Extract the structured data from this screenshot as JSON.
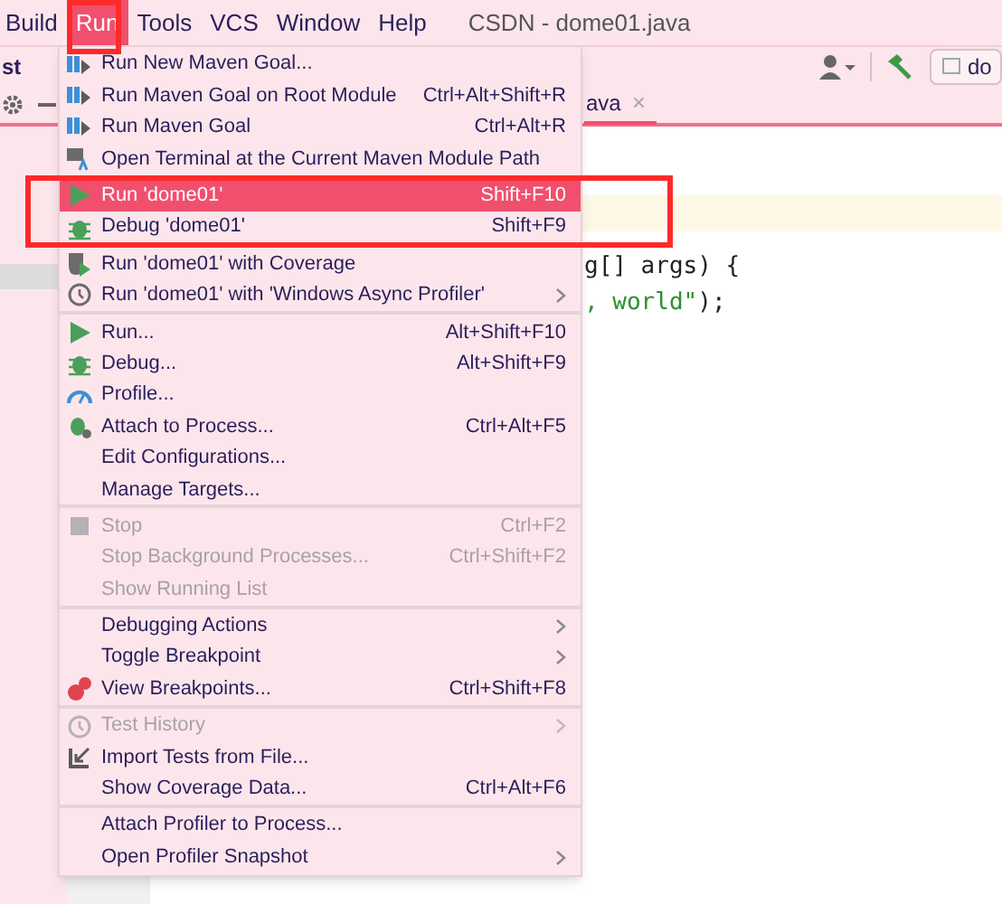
{
  "menubar": {
    "items": [
      {
        "label": "Build",
        "selected": false
      },
      {
        "label": "Run",
        "selected": true
      },
      {
        "label": "Tools",
        "selected": false
      },
      {
        "label": "VCS",
        "selected": false
      },
      {
        "label": "Window",
        "selected": false
      },
      {
        "label": "Help",
        "selected": false
      }
    ],
    "title": "CSDN - dome01.java"
  },
  "navbar": {
    "crumb": "st",
    "field": "do"
  },
  "editor": {
    "tab": {
      "label": "ava",
      "close": "×"
    },
    "lines": [
      [
        {
          "text": "g[] args) {",
          "kind": "plain"
        }
      ],
      [
        {
          "text": ", world\"",
          "kind": "string"
        },
        {
          "text": ");",
          "kind": "plain"
        }
      ]
    ]
  },
  "menu": {
    "groups": [
      [
        {
          "label": "Run New Maven Goal...",
          "submenu": false,
          "disabled": false,
          "selected": false
        },
        {
          "label": "Run Maven Goal on Root Module",
          "shortcut": "Ctrl+Alt+Shift+R",
          "submenu": false,
          "disabled": false,
          "selected": false
        },
        {
          "label": "Run Maven Goal",
          "shortcut": "Ctrl+Alt+R",
          "submenu": false,
          "disabled": false,
          "selected": false
        },
        {
          "label": "Open Terminal at the Current Maven Module Path",
          "submenu": false,
          "disabled": false,
          "selected": false
        },
        {
          "label": "Run 'dome01'",
          "shortcut": "Shift+F10",
          "submenu": false,
          "disabled": false,
          "selected": true
        },
        {
          "label": "Debug 'dome01'",
          "shortcut": "Shift+F9",
          "submenu": false,
          "disabled": false,
          "selected": false
        },
        {
          "label": "Run 'dome01' with Coverage",
          "submenu": false,
          "disabled": false,
          "selected": false
        },
        {
          "label": "Run 'dome01' with 'Windows Async Profiler'",
          "submenu": true,
          "disabled": false,
          "selected": false
        }
      ],
      [
        {
          "label": "Run...",
          "shortcut": "Alt+Shift+F10",
          "submenu": false,
          "disabled": false,
          "selected": false
        },
        {
          "label": "Debug...",
          "shortcut": "Alt+Shift+F9",
          "submenu": false,
          "disabled": false,
          "selected": false
        },
        {
          "label": "Profile...",
          "submenu": false,
          "disabled": false,
          "selected": false
        },
        {
          "label": "Attach to Process...",
          "shortcut": "Ctrl+Alt+F5",
          "submenu": false,
          "disabled": false,
          "selected": false
        },
        {
          "label": "Edit Configurations...",
          "submenu": false,
          "disabled": false,
          "selected": false
        },
        {
          "label": "Manage Targets...",
          "submenu": false,
          "disabled": false,
          "selected": false
        }
      ],
      [
        {
          "label": "Stop",
          "shortcut": "Ctrl+F2",
          "submenu": false,
          "disabled": true,
          "selected": false
        },
        {
          "label": "Stop Background Processes...",
          "shortcut": "Ctrl+Shift+F2",
          "submenu": false,
          "disabled": true,
          "selected": false
        },
        {
          "label": "Show Running List",
          "submenu": false,
          "disabled": true,
          "selected": false
        }
      ],
      [
        {
          "label": "Debugging Actions",
          "submenu": true,
          "disabled": false,
          "selected": false
        },
        {
          "label": "Toggle Breakpoint",
          "submenu": true,
          "disabled": false,
          "selected": false
        },
        {
          "label": "View Breakpoints...",
          "shortcut": "Ctrl+Shift+F8",
          "submenu": false,
          "disabled": false,
          "selected": false
        }
      ],
      [
        {
          "label": "Test History",
          "submenu": true,
          "disabled": true,
          "selected": false
        },
        {
          "label": "Import Tests from File...",
          "submenu": false,
          "disabled": false,
          "selected": false
        },
        {
          "label": "Show Coverage Data...",
          "shortcut": "Ctrl+Alt+F6",
          "submenu": false,
          "disabled": false,
          "selected": false
        }
      ],
      [
        {
          "label": "Attach Profiler to Process...",
          "submenu": false,
          "disabled": false,
          "selected": false
        },
        {
          "label": "Open Profiler Snapshot",
          "submenu": true,
          "disabled": false,
          "selected": false
        }
      ]
    ]
  }
}
